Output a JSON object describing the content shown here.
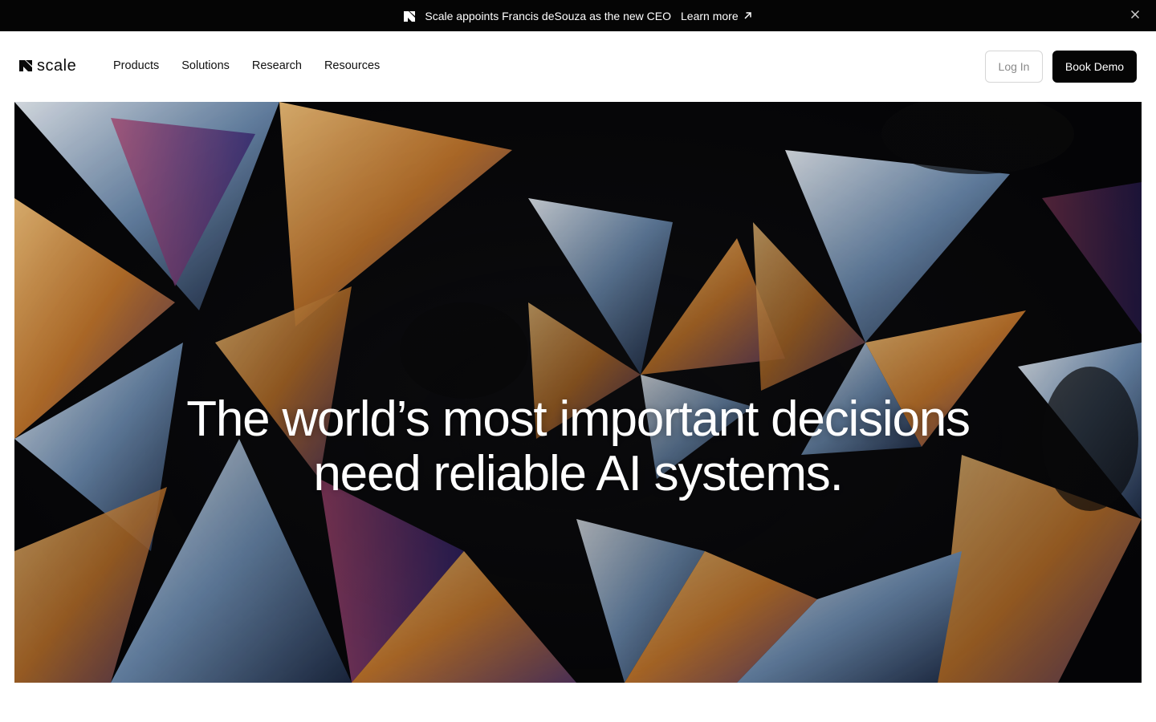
{
  "announcement": {
    "text": "Scale appoints Francis deSouza as the new CEO",
    "link_label": "Learn more",
    "icons": {
      "logo": "scale-logo-icon",
      "arrow": "arrow-up-right-icon",
      "close": "close-icon"
    }
  },
  "nav": {
    "brand": "scale",
    "links": [
      "Products",
      "Solutions",
      "Research",
      "Resources"
    ],
    "login_label": "Log In",
    "demo_label": "Book Demo"
  },
  "hero": {
    "title_line1": "The world’s most important decisions",
    "title_line2": "need reliable AI systems.",
    "image": "crystal-micrograph-image"
  },
  "colors": {
    "announcement_bg": "#050505",
    "primary_button_bg": "#050505",
    "secondary_button_border": "#d6d6d6",
    "text": "#0b0b0b"
  }
}
